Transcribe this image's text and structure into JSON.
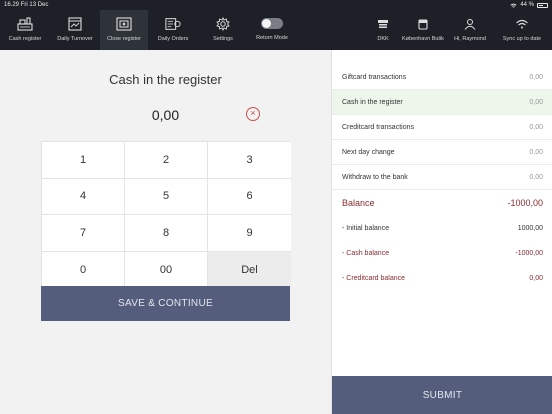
{
  "status": {
    "time": "16.29",
    "date": "Fri 13 Dec",
    "battery": "44 %"
  },
  "nav": {
    "items": [
      {
        "label": "Cash register",
        "icon": "cash-register-icon"
      },
      {
        "label": "Daily Turnover",
        "icon": "calendar-icon"
      },
      {
        "label": "Close register",
        "icon": "close-register-icon"
      },
      {
        "label": "Daily Orders",
        "icon": "daily-orders-icon"
      },
      {
        "label": "Settings",
        "icon": "gear-icon"
      },
      {
        "label": "Return Mode",
        "icon": "toggle-icon"
      }
    ],
    "right_items": [
      {
        "label": "DKK",
        "icon": "currency-icon"
      },
      {
        "label": "København Butik",
        "icon": "store-icon"
      },
      {
        "label": "Hi, Raymond",
        "icon": "user-icon"
      },
      {
        "label": "Sync up to date",
        "icon": "wifi-icon"
      }
    ]
  },
  "register": {
    "title": "Cash in the register",
    "amount": "0,00",
    "clear_symbol": "×"
  },
  "keypad": {
    "keys": [
      "1",
      "2",
      "3",
      "4",
      "5",
      "6",
      "7",
      "8",
      "9",
      "0",
      "00",
      "Del"
    ],
    "save_label": "SAVE & CONTINUE"
  },
  "summary": {
    "rows": [
      {
        "label": "Giftcard transactions",
        "value": "0,00"
      },
      {
        "label": "Cash in the register",
        "value": "0,00"
      },
      {
        "label": "Creditcard transactions",
        "value": "0,00"
      },
      {
        "label": "Next day change",
        "value": "0,00"
      },
      {
        "label": "Withdraw to the bank",
        "value": "0,00"
      }
    ],
    "balance": {
      "label": "Balance",
      "value": "-1000,00"
    },
    "initial_balance": {
      "label": "- Initial balance",
      "value": "1000,00"
    },
    "cash_balance": {
      "label": "- Cash balance",
      "value": "-1000,00"
    },
    "creditcard_balance": {
      "label": "- Creditcard balance",
      "value": "0,00"
    },
    "submit_label": "SUBMIT"
  },
  "colors": {
    "accent": "#545d7c",
    "topbar": "#1d2127",
    "negative": "#8b2b2f",
    "clear": "#c9504e"
  }
}
